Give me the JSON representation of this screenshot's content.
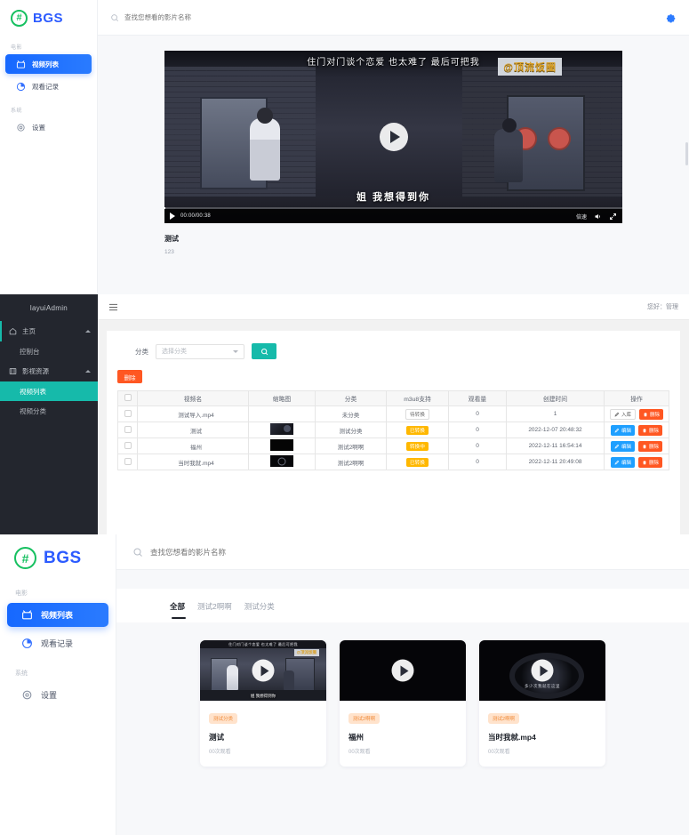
{
  "panel_player": {
    "brand": {
      "name": "BGS",
      "logo_icon": "hash-circle-icon"
    },
    "search": {
      "placeholder": "查找您想看的影片名称",
      "icon": "search-icon",
      "value": ""
    },
    "settings_icon": "gear-icon",
    "sidebar": {
      "groups": [
        {
          "label": "电影",
          "items": [
            {
              "label": "视频列表",
              "icon": "tv-icon",
              "active": true
            },
            {
              "label": "观看记录",
              "icon": "history-pie-icon",
              "active": false
            }
          ]
        },
        {
          "label": "系统",
          "items": [
            {
              "label": "设置",
              "icon": "gear-icon",
              "active": false
            }
          ]
        }
      ]
    },
    "video": {
      "subtitle_top": "住门对门谈个恋爱 也太难了 最后可把我",
      "watermark": "@顶流饭圈",
      "subtitle_bottom": "姐 我想得到你",
      "play_icon": "play-icon",
      "controls": {
        "play_icon": "play-icon",
        "time": "00:00/00:38",
        "speed_label": "倍速",
        "volume_icon": "volume-icon",
        "fullscreen_icon": "fullscreen-icon"
      }
    },
    "meta": {
      "title": "测试",
      "description": "123"
    }
  },
  "panel_admin": {
    "logo": "layuiAdmin",
    "hamburger_icon": "menu-icon",
    "greeting": "您好：管理",
    "sidebar": [
      {
        "label": "主页",
        "icon": "home-icon",
        "type": "parent",
        "expanded": true,
        "children": [
          {
            "label": "控制台",
            "active": false
          }
        ]
      },
      {
        "label": "影视资源",
        "icon": "film-icon",
        "type": "parent",
        "expanded": true,
        "children": [
          {
            "label": "视频列表",
            "active": true
          },
          {
            "label": "视频分类",
            "active": false
          }
        ]
      }
    ],
    "filter": {
      "label": "分类",
      "select_placeholder": "选择分类",
      "search_icon": "search-icon"
    },
    "delete_button": "删除",
    "table": {
      "columns": [
        "",
        "视频名",
        "缩略图",
        "分类",
        "m3u8支持",
        "观看量",
        "创建时间",
        "操作"
      ],
      "rows": [
        {
          "name": "测试导入.mp4",
          "thumb": "none",
          "category": "未分类",
          "m3u8": "待转换",
          "m3u8_style": "plain",
          "views": "0",
          "created": "1",
          "actions": [
            {
              "label": "入库",
              "style": "ghost",
              "icon": "pencil-icon"
            },
            {
              "label": "删除",
              "style": "del",
              "icon": "trash-icon"
            }
          ]
        },
        {
          "name": "测试",
          "thumb": "a",
          "category": "测试分类",
          "m3u8": "已转换",
          "m3u8_style": "warn",
          "views": "0",
          "created": "2022-12-07 20:48:32",
          "actions": [
            {
              "label": "编辑",
              "style": "edit",
              "icon": "pencil-icon"
            },
            {
              "label": "删除",
              "style": "del",
              "icon": "trash-icon"
            }
          ]
        },
        {
          "name": "福州",
          "thumb": "b",
          "category": "测试2啊啊",
          "m3u8": "转换中",
          "m3u8_style": "warn",
          "views": "0",
          "created": "2022-12-11 16:54:14",
          "actions": [
            {
              "label": "编辑",
              "style": "edit",
              "icon": "pencil-icon"
            },
            {
              "label": "删除",
              "style": "del",
              "icon": "trash-icon"
            }
          ]
        },
        {
          "name": "当时我就.mp4",
          "thumb": "c",
          "category": "测试2啊啊",
          "m3u8": "已转换",
          "m3u8_style": "warn",
          "views": "0",
          "created": "2022-12-11 20:49:08",
          "actions": [
            {
              "label": "编辑",
              "style": "edit",
              "icon": "pencil-icon"
            },
            {
              "label": "删除",
              "style": "del",
              "icon": "trash-icon"
            }
          ]
        }
      ]
    }
  },
  "panel_list": {
    "brand": {
      "name": "BGS",
      "logo_icon": "hash-circle-icon"
    },
    "search": {
      "placeholder": "查找您想看的影片名称",
      "icon": "search-icon",
      "value": ""
    },
    "sidebar": {
      "groups": [
        {
          "label": "电影",
          "items": [
            {
              "label": "视频列表",
              "icon": "tv-icon",
              "active": true
            },
            {
              "label": "观看记录",
              "icon": "history-pie-icon",
              "active": false
            }
          ]
        },
        {
          "label": "系统",
          "items": [
            {
              "label": "设置",
              "icon": "gear-icon",
              "active": false
            }
          ]
        }
      ]
    },
    "tabs": [
      {
        "label": "全部",
        "active": true
      },
      {
        "label": "测试2啊啊",
        "active": false
      },
      {
        "label": "测试分类",
        "active": false
      }
    ],
    "cards": [
      {
        "tag": "测试分类",
        "title": "测试",
        "views": "00次观看",
        "thumb_strip": "住门对门谈个恋爱 也太难了 最后可把我",
        "thumb_wm": "@顶流饭圈",
        "thumb_sub": "姐 我想得到你",
        "thumb_kind": "one",
        "play_icon": "play-icon"
      },
      {
        "tag": "测试2啊啊",
        "title": "福州",
        "views": "00次观看",
        "thumb_strip": "",
        "thumb_wm": "",
        "thumb_sub": "",
        "thumb_kind": "two",
        "play_icon": "play-icon"
      },
      {
        "tag": "测试2啊啊",
        "title": "当时我就.mp4",
        "views": "00次观看",
        "thumb_strip": "",
        "thumb_wm": "",
        "thumb_sub": "多少次我就在这里",
        "thumb_kind": "three",
        "play_icon": "play-icon"
      }
    ]
  },
  "colors": {
    "brand_blue": "#2c5bff",
    "nav_active": "#1668ff",
    "logo_green": "#16c060",
    "layui_teal": "#16baaa",
    "layui_dark": "#23262e",
    "warn_orange": "#ffb800",
    "danger_red": "#ff5722",
    "edit_blue": "#1e9fff",
    "tag_bg": "#ffe3cc",
    "tag_text": "#f08b3a"
  }
}
